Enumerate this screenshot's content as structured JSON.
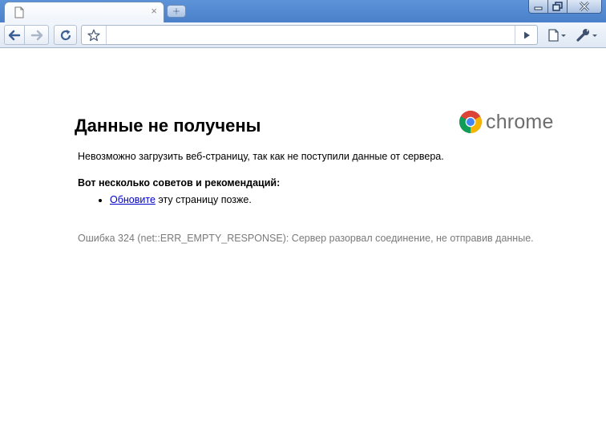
{
  "tabs": [
    {
      "title": "",
      "close_label": "×"
    }
  ],
  "toolbar": {
    "address_value": "",
    "address_placeholder": ""
  },
  "page": {
    "title": "Данные не получены",
    "logo_text": "chrome",
    "summary": "Невозможно загрузить веб-страницу, так как не поступили данные от сервера.",
    "suggestions_heading": "Вот несколько советов и рекомендаций:",
    "suggestion": {
      "link_text": "Обновите",
      "rest_text": " эту страницу позже."
    },
    "error_details": "Ошибка 324 (net::ERR_EMPTY_RESPONSE): Сервер разорвал соединение, не отправив данные."
  },
  "icons": {
    "back": "arrow-left-icon",
    "forward": "arrow-right-icon",
    "reload": "reload-icon",
    "bookmark": "star-icon",
    "go": "play-icon",
    "page_menu": "page-icon",
    "tools_menu": "wrench-icon",
    "new_tab": "plus-icon",
    "logo": "chrome-logo-icon"
  },
  "colors": {
    "titlebar": "#4a80c9",
    "link": "#0000cc",
    "error_text": "#7a7a7a",
    "logo_red": "#db4437",
    "logo_green": "#0f9d58",
    "logo_yellow": "#f4b400",
    "logo_blue": "#4285f4"
  }
}
